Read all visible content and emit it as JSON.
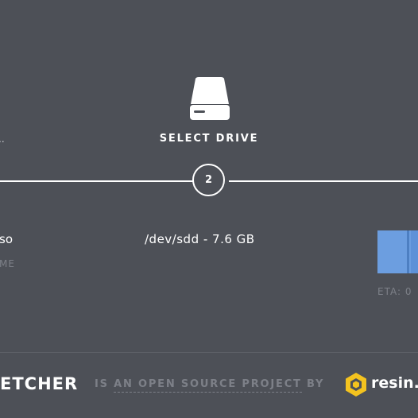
{
  "steps": {
    "left_stub": "..",
    "drive": {
      "label": "SELECT DRIVE",
      "number": "2",
      "icon": "hard-drive-icon"
    }
  },
  "image": {
    "name": "so",
    "subtitle": "ME"
  },
  "drive": {
    "info": "/dev/sdd - 7.6 GB"
  },
  "flash": {
    "progress": 0.7,
    "eta": "ETA: 0"
  },
  "footer": {
    "brand": "ETCHER",
    "tagline_prefix": "IS",
    "tagline_link": "AN OPEN SOURCE PROJECT",
    "tagline_suffix": "BY",
    "company": "resin.i",
    "company_logo_icon": "resin-logo-icon"
  },
  "colors": {
    "background": "#4d5057",
    "accent": "#5e91d8",
    "text": "#ffffff",
    "muted": "#7d8088",
    "logo": "#f4c31f"
  }
}
